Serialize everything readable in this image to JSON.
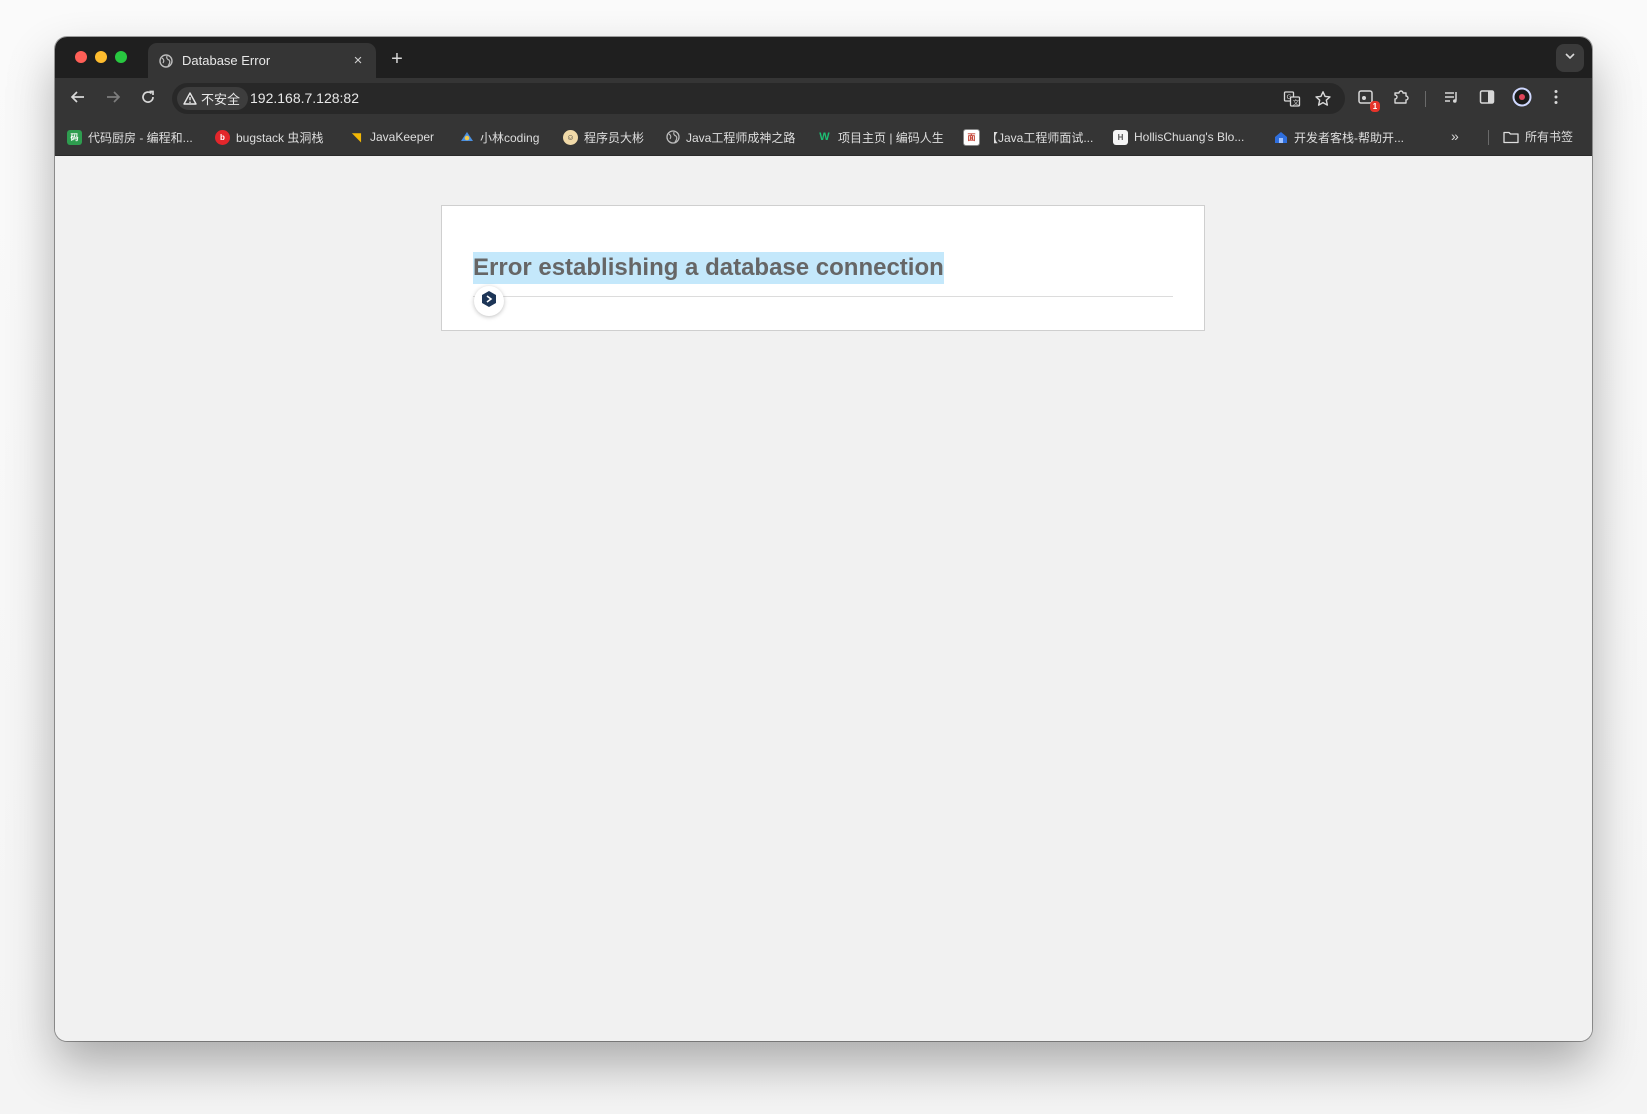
{
  "window": {
    "tab_title": "Database Error",
    "tab_close": "×",
    "new_tab": "+"
  },
  "toolbar": {
    "security_label": "不安全",
    "url": "192.168.7.128:82",
    "extension_badge": "1"
  },
  "bookmarks": {
    "items": [
      {
        "label": "代码厨房 - 编程和...",
        "icon": "code-kitchen-icon",
        "color": "#2e9d4f"
      },
      {
        "label": "bugstack 虫洞栈",
        "icon": "bugstack-icon",
        "color": "#e3262b"
      },
      {
        "label": "JavaKeeper",
        "icon": "javakeeper-icon",
        "color": "#f2b705"
      },
      {
        "label": "小林coding",
        "icon": "xiaolin-icon",
        "color": "#4a90e2"
      },
      {
        "label": "程序员大彬",
        "icon": "dabin-icon",
        "color": "#f0d9a8"
      },
      {
        "label": "Java工程师成神之路",
        "icon": "globe-icon",
        "color": "#9a9a9a"
      },
      {
        "label": "项目主页 | 编码人生",
        "icon": "w-icon",
        "color": "#1dbf73"
      },
      {
        "label": "【Java工程师面试...",
        "icon": "interview-icon",
        "color": "#ffffff"
      },
      {
        "label": "HollisChuang's Blo...",
        "icon": "hollis-icon",
        "color": "#f5f5f5"
      },
      {
        "label": "开发者客栈-帮助开...",
        "icon": "kezhan-icon",
        "color": "#2f6fde"
      }
    ],
    "more": "»",
    "all_bookmarks": "所有书签"
  },
  "page": {
    "heading": "Error establishing a database connection"
  },
  "colors": {
    "highlight": "#c4e8fb",
    "heading_text": "#666666",
    "page_background": "#f1f1f1"
  }
}
